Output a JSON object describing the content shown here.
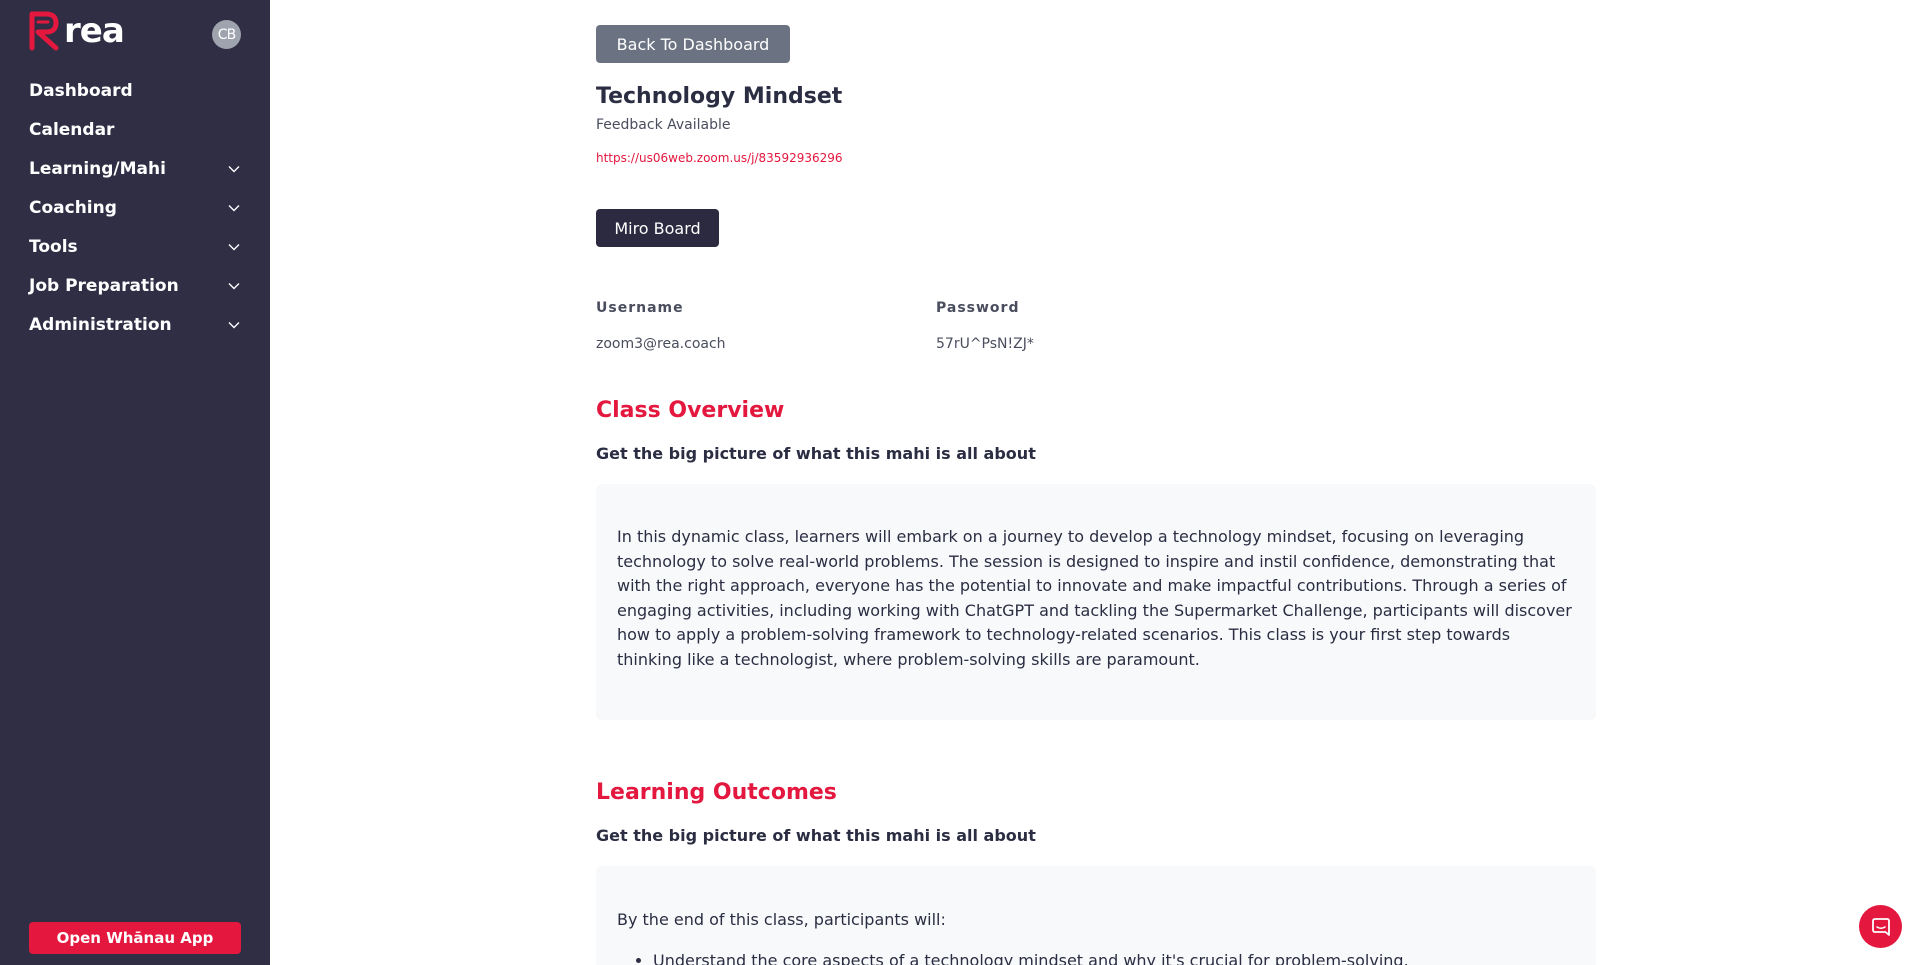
{
  "sidebar": {
    "brand": "rea",
    "avatar_initials": "CB",
    "items": [
      {
        "label": "Dashboard",
        "expandable": false
      },
      {
        "label": "Calendar",
        "expandable": false
      },
      {
        "label": "Learning/Mahi",
        "expandable": true
      },
      {
        "label": "Coaching",
        "expandable": true
      },
      {
        "label": "Tools",
        "expandable": true
      },
      {
        "label": "Job Preparation",
        "expandable": true
      },
      {
        "label": "Administration",
        "expandable": true
      }
    ],
    "open_app_label": "Open Whānau App"
  },
  "main": {
    "back_label": "Back To Dashboard",
    "title": "Technology Mindset",
    "feedback": "Feedback Available",
    "zoom_link": "https://us06web.zoom.us/j/83592936296",
    "miro_label": "Miro Board",
    "username_label": "Username",
    "username_value": "zoom3@rea.coach",
    "password_label": "Password",
    "password_value": "57rU^PsN!ZJ*",
    "overview": {
      "heading": "Class Overview",
      "sub": "Get the big picture of what this mahi is all about",
      "body": "In this dynamic class, learners will embark on a journey to develop a technology mindset, focusing on leveraging technology to solve real-world problems. The session is designed to inspire and instil confidence, demonstrating that with the right approach, everyone has the potential to innovate and make impactful contributions. Through a series of engaging activities, including working with ChatGPT and tackling the Supermarket Challenge, participants will discover how to apply a problem-solving framework to technology-related scenarios. This class is your first step towards thinking like a technologist, where problem-solving skills are paramount."
    },
    "outcomes": {
      "heading": "Learning Outcomes",
      "sub": "Get the big picture of what this mahi is all about",
      "intro": "By the end of this class, participants will:",
      "items": [
        "Understand the core aspects of a technology mindset and why it's crucial for problem-solving."
      ]
    }
  },
  "colors": {
    "sidebar_bg": "#2f2e45",
    "accent": "#e4173e",
    "back_button": "#6b7282",
    "dark_button": "#2b2a40",
    "card_bg": "#f8f9fb"
  },
  "icons": {
    "logo": "rea-logo-icon",
    "chevron": "chevron-down-icon",
    "chat": "chat-icon"
  }
}
